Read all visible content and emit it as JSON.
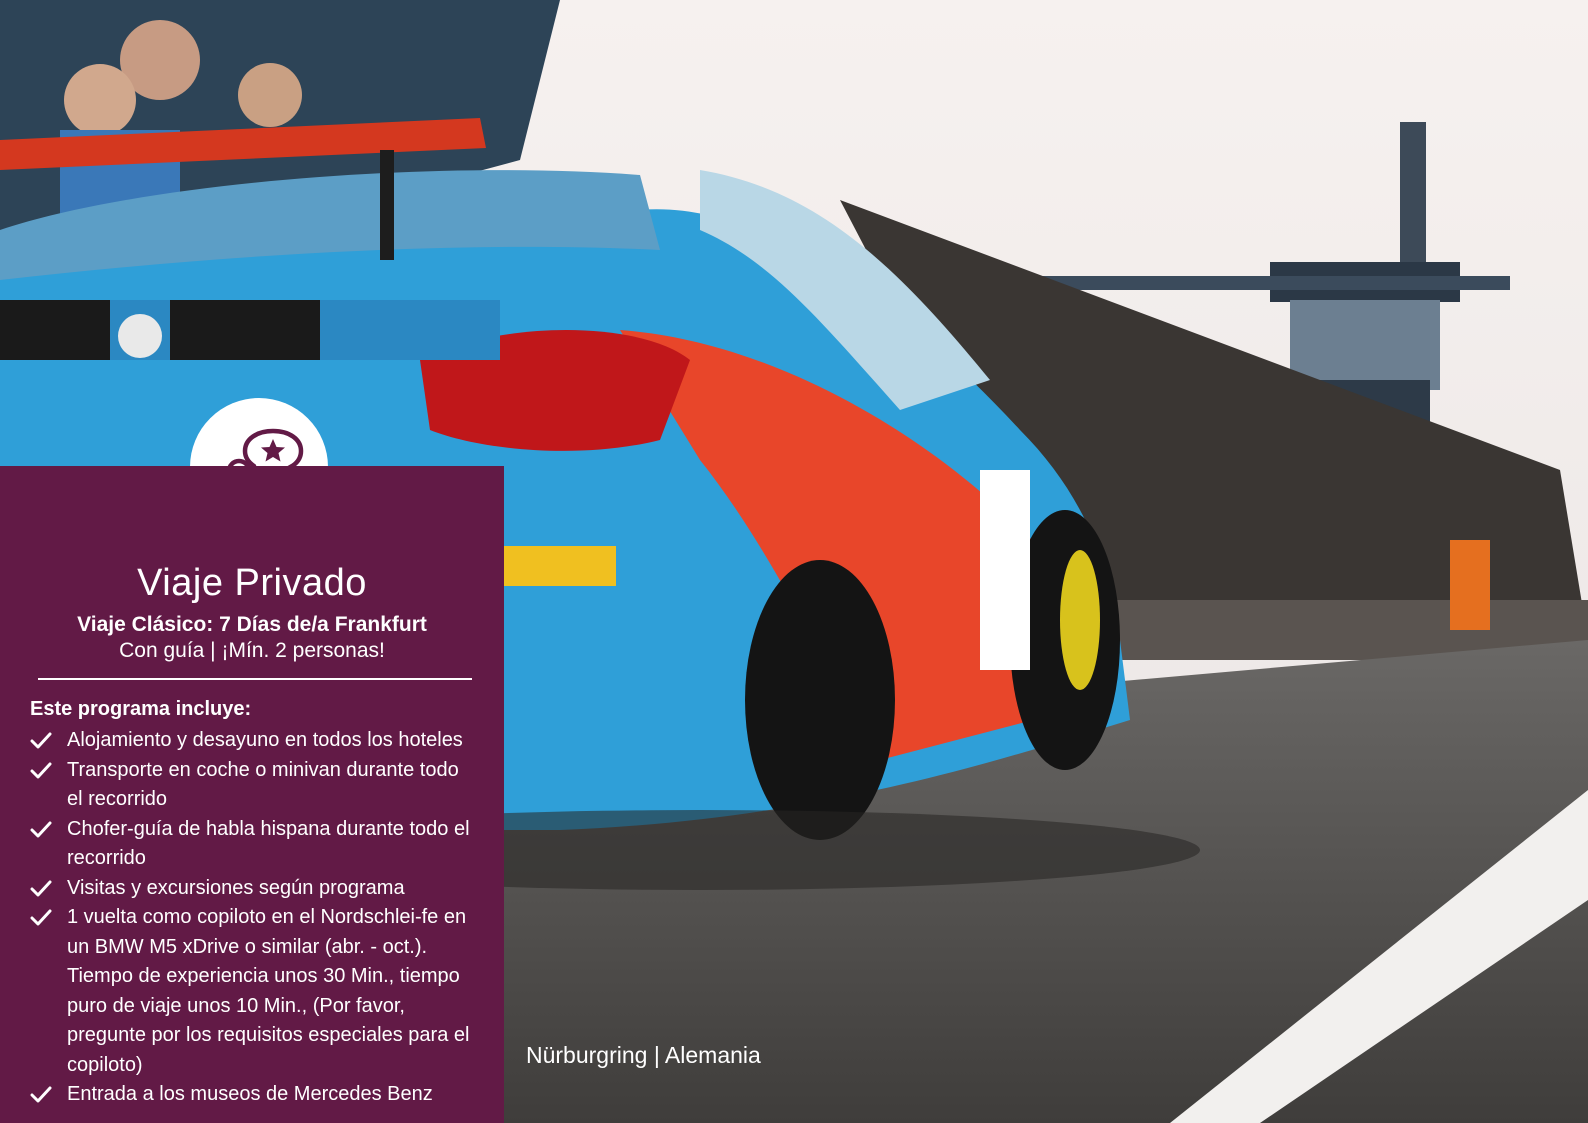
{
  "photo": {
    "subject": "race-car-photo",
    "caption": "Nürburgring | Alemania",
    "colors": {
      "sky": "#f3eeec",
      "car_blue": "#2f9fd8",
      "car_red": "#e8462a",
      "asphalt": "#4b4a48"
    }
  },
  "panel": {
    "badge_icon": "person-speech-star-icon",
    "title": "Viaje Privado",
    "subtitle": "Viaje Clásico: 7 Días de/a Frankfurt",
    "meta": "Con guía | ¡Mín. 2 personas!",
    "includes_heading": "Este programa incluye:",
    "includes": [
      "Alojamiento y desayuno en todos los hoteles",
      "Transporte en coche o minivan durante todo el recorrido",
      "Chofer-guía de habla hispana durante todo el recorrido",
      "Visitas y excursiones según programa",
      "1 vuelta como copiloto en el Nordschlei-fe en un BMW M5 xDrive o similar (abr. - oct.). Tiempo de experiencia unos 30 Min., tiempo puro de viaje unos 10 Min., (Por favor, pregunte por los requisitos especiales para el copiloto)",
      "Entrada a los museos de Mercedes Benz"
    ],
    "colors": {
      "background": "#621a46",
      "text": "#ffffff"
    }
  }
}
